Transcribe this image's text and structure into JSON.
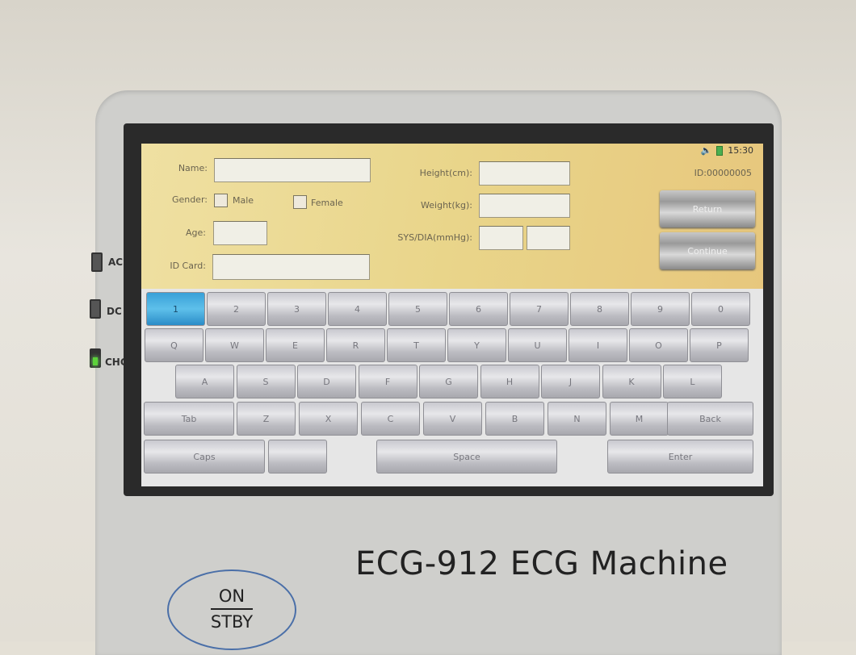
{
  "device": {
    "brand_label": "ECG-912 ECG Machine",
    "power_top": "ON",
    "power_bottom": "STBY",
    "leds": [
      {
        "label": "AC",
        "on": false
      },
      {
        "label": "DC",
        "on": false
      },
      {
        "label": "CHG",
        "on": true,
        "color": "#5cd23a"
      }
    ]
  },
  "status": {
    "time": "15:30",
    "icons": [
      "speaker-icon",
      "battery-icon"
    ],
    "patient_id": "ID:00000005"
  },
  "form": {
    "name_label": "Name:",
    "name_value": "",
    "gender_label": "Gender:",
    "male_label": "Male",
    "female_label": "Female",
    "male_checked": false,
    "female_checked": false,
    "age_label": "Age:",
    "age_value": "",
    "idcard_label": "ID Card:",
    "idcard_value": "",
    "height_label": "Height(cm):",
    "height_value": "",
    "weight_label": "Weight(kg):",
    "weight_value": "",
    "sysdia_label": "SYS/DIA(mmHg):",
    "sys_value": "",
    "dia_value": ""
  },
  "buttons": {
    "return": "Return",
    "continue": "Continue"
  },
  "keyboard": {
    "active_key": "1",
    "rows": [
      [
        "1",
        "2",
        "3",
        "4",
        "5",
        "6",
        "7",
        "8",
        "9",
        "0"
      ],
      [
        "Q",
        "W",
        "E",
        "R",
        "T",
        "Y",
        "U",
        "I",
        "O",
        "P"
      ],
      [
        "A",
        "S",
        "D",
        "F",
        "G",
        "H",
        "J",
        "K",
        "L"
      ],
      [
        "Tab",
        "Z",
        "X",
        "C",
        "V",
        "B",
        "N",
        "M",
        "Back"
      ],
      [
        "Caps",
        "",
        "Space",
        "Enter"
      ]
    ]
  }
}
